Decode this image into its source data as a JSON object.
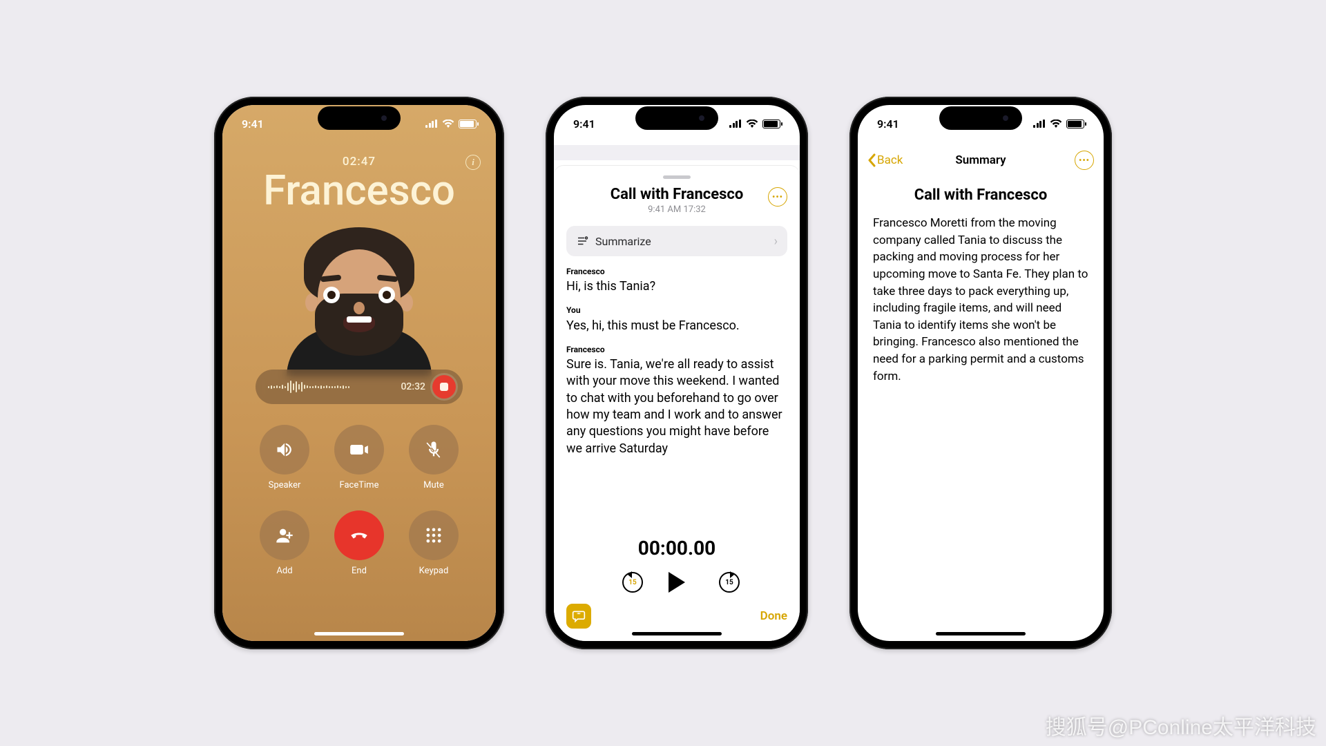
{
  "status": {
    "time": "9:41"
  },
  "phone1": {
    "timer": "02:47",
    "name": "Francesco",
    "rec_time": "02:32",
    "buttons": {
      "speaker": "Speaker",
      "facetime": "FaceTime",
      "mute": "Mute",
      "add": "Add",
      "end": "End",
      "keypad": "Keypad"
    }
  },
  "phone2": {
    "title": "Call with Francesco",
    "subtitle": "9:41 AM  17:32",
    "summarize_label": "Summarize",
    "messages": [
      {
        "who": "Francesco",
        "text": "Hi, is this Tania?"
      },
      {
        "who": "You",
        "text": "Yes, hi, this must be Francesco."
      },
      {
        "who": "Francesco",
        "text": "Sure is. Tania, we're all ready to assist with your move this weekend. I wanted to chat with you beforehand to go over how my team and I work and to answer any questions you might have before we arrive Saturday"
      }
    ],
    "player_time": "00:00.00",
    "skip_back": "15",
    "skip_fwd": "15",
    "done": "Done"
  },
  "phone3": {
    "back": "Back",
    "nav_title": "Summary",
    "title": "Call with Francesco",
    "body": "Francesco Moretti from the moving company called Tania to discuss the packing and moving process for her upcoming move to Santa Fe. They plan to take three days to pack everything up, including fragile items, and will need Tania to identify items she won't be bringing. Francesco also mentioned the need for a parking permit and a customs form."
  },
  "watermark": "搜狐号@PConline太平洋科技"
}
